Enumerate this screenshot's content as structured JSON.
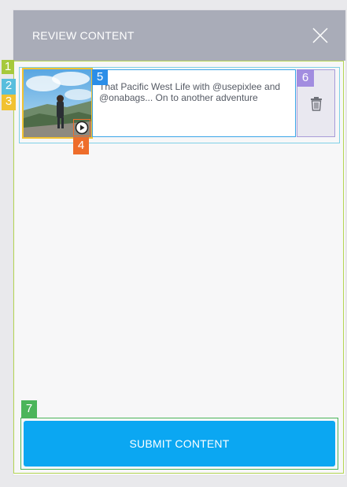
{
  "header": {
    "title": "REVIEW CONTENT",
    "close_icon": "close-icon"
  },
  "item": {
    "caption": "That Pacific West Life with @usepixlee and @onabags... On to another adventure",
    "media_icon": "play-icon",
    "delete_icon": "trash-icon"
  },
  "footer": {
    "submit_label": "SUBMIT CONTENT"
  },
  "annotations": [
    "1",
    "2",
    "3",
    "4",
    "5",
    "6",
    "7"
  ],
  "colors": {
    "header_bg": "#a9acb8",
    "submit_bg": "#0ba7f2",
    "annotation_1": "#a6c93b",
    "annotation_2": "#58bedd",
    "annotation_3": "#f1c232",
    "annotation_4": "#ee6d2b",
    "annotation_5": "#2b8ee8",
    "annotation_6": "#a28de0",
    "annotation_7": "#4bb55a"
  }
}
